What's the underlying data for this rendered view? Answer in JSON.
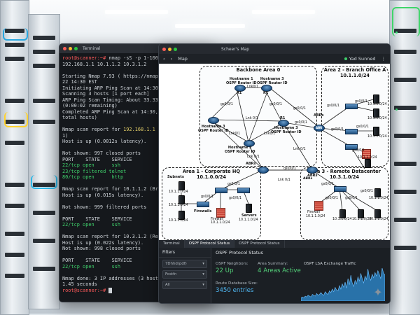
{
  "terminal": {
    "title": "Terminal",
    "prompt": "root@scanner:~#",
    "command": "nmap -sS -p 1-1000 -T4 -v 192.168.1.1 10.1.1.2 10.3.1.2",
    "lines": [
      {
        "text": "",
        "cls": ""
      },
      {
        "text": "Starting Nmap 7.93 ( https://nmap.org ) at 2024-05-22 14:30 EST",
        "cls": ""
      },
      {
        "text": "Initiating ARP Ping Scan at 14:30",
        "cls": ""
      },
      {
        "text": "Scanning 3 hosts [1 port each]",
        "cls": ""
      },
      {
        "text": "ARP Ping Scan Timing: About 33.33% done; ETC: 14:30 (0:00:02 remaining)",
        "cls": ""
      },
      {
        "text": "Completed ARP Ping Scan at 14:30, 0.01s elapsed (3 total hosts)",
        "cls": ""
      },
      {
        "text": "",
        "cls": ""
      },
      {
        "text": "Nmap scan report for 192.168.1.1 (Backbone Router 1)",
        "cls": "y1"
      },
      {
        "text": "Host is up (0.0012s latency).",
        "cls": ""
      },
      {
        "text": "",
        "cls": ""
      },
      {
        "text": "Not shown: 997 closed ports",
        "cls": ""
      },
      {
        "text": "PORT    STATE    SERVICE",
        "cls": ""
      },
      {
        "text": "22/tcp open      ssh",
        "cls": "g"
      },
      {
        "text": "23/tcp filtered telnet",
        "cls": "g"
      },
      {
        "text": "80/tcp open      http",
        "cls": "g"
      },
      {
        "text": "",
        "cls": ""
      },
      {
        "text": "Nmap scan report for 10.1.1.2 (Branch A Server)",
        "cls": ""
      },
      {
        "text": "Host is up (0.015s latency).",
        "cls": ""
      },
      {
        "text": "",
        "cls": ""
      },
      {
        "text": "Not shown: 999 filtered ports",
        "cls": ""
      },
      {
        "text": "",
        "cls": ""
      },
      {
        "text": "PORT    STATE    SERVICE",
        "cls": ""
      },
      {
        "text": "22/tcp open      ssh",
        "cls": "g"
      },
      {
        "text": "",
        "cls": ""
      },
      {
        "text": "Nmap scan report for 10.3.1.2 (Remote Server)",
        "cls": ""
      },
      {
        "text": "Host is up (0.022s latency).",
        "cls": ""
      },
      {
        "text": "Not shown: 998 closed ports",
        "cls": ""
      },
      {
        "text": "",
        "cls": ""
      },
      {
        "text": "PORT    STATE    SERVICE",
        "cls": ""
      },
      {
        "text": "22/tcp open      ssh",
        "cls": "g"
      },
      {
        "text": "",
        "cls": ""
      },
      {
        "text": "Nmap done: 3 IP addresses (3 hosts up) scanned in 1.45 seconds",
        "cls": ""
      }
    ],
    "final_prompt": "root@scanner:~#"
  },
  "map": {
    "window_title": "Scheer's Map",
    "toolbar_label": "Map",
    "status_label": "Yad Sunned",
    "areas": {
      "backbone": "Backbone Area 0",
      "branch_b_title": "Area 2 - Branch Office A",
      "branch_b_subnet": "10.1.1.0/24",
      "corp_title": "Area 1 - Corporate HQ",
      "corp_subnet": "10.1.0.0/24",
      "remote_title": "Area 3 - Remote Datacenter",
      "remote_subnet": "10.3.1.0/24"
    },
    "labels": {
      "h1": "Hostname 1",
      "h1b": "OSPF Router ID",
      "h2": "Hostname 3",
      "h2b": "OSPF Router ID",
      "h3": "Hostname 3",
      "h3b": "OSPF Router ID",
      "h4": "Hostname 3",
      "h4b": "OSPF Router ID",
      "h5": "Hostname 2",
      "h5b": "OSPF Router ID",
      "r1": "R1",
      "r2": "R1",
      "r3": "R1",
      "abrs_top": "ABRs",
      "abr": "ABR",
      "abrs_mid": "ABRs",
      "abrs_right": "ABRs",
      "abr_right": "ABRs",
      "subnets": "Subnets",
      "sub1": "10.1.1.0/24",
      "sub2": "10.1.1.0/24",
      "firewalls": "Firewalls",
      "firewall1": "Firewall",
      "servers": "Servers",
      "firewall2": "Firewall",
      "srv_a1": "10.1.1.0/24",
      "srv_a2": "10.1.1.0/24",
      "srv_a3": "10.1.1.0/24",
      "srv_a4": "10.1.1.0/24",
      "srv_c1": "10.1.1.0/24",
      "srv_c2": "10.1.1.0/24",
      "srv_c3": "10.1.1.0/24",
      "srv_c4": "10.1.1.0/24",
      "srv_c5": "10.1.1.0/24",
      "corp_fw_sub": "10.1.1.0/24",
      "corp_srv_sub": "10.1.1.0/24",
      "corp_sub3": "10.1.1.0/24",
      "link1": "gs0/0/1",
      "link2": "gs0/0/1",
      "link3": "Lnk0/1",
      "link4": "Lnk 0/1",
      "link5": "Lnk 0/1",
      "link6": "Lnk 0/1",
      "link7": "gs0/0/1",
      "link8": "gs0/0/1",
      "link9": "Lnk0/1",
      "link10": "Lnk0/1",
      "link11": "gs0/0/1",
      "link12": "gs0/0/1",
      "link13": "gs0/0/1",
      "link14": "gs0/0/1",
      "link15": "gs0/0/1",
      "link16": "gs0/0/1",
      "link17": "gs0/0/1",
      "link18": "gs0/0/1",
      "link19": "gs0/0/1",
      "link20": "gs0/0/1",
      "link21": "Lnk 0/1",
      "link22": "gs0/0/1",
      "link23": "gs0/0/1",
      "link24": "gs0/0/1"
    }
  },
  "panels": {
    "tabs": [
      "Terminal",
      "OSPF Protocol Status",
      "OSPF Protocol Status"
    ],
    "filters": "Filters",
    "filter1": "7Dhhd(pdf)",
    "filter2": "Fostfn",
    "filter3": "All",
    "status_title": "OSPF Protocol Status",
    "neighbors_label": "OSPF Neighbors:",
    "neighbors_value": "22 Up",
    "area_label": "Area Summary:",
    "area_value": "4 Areas Active",
    "lsa_label": "OSPF LSA Exchange Traffic",
    "db_label": "Route Database Size:",
    "db_value": "3450 entries"
  },
  "colors": {
    "prompt": "#ff5a5a",
    "open_port": "#3fd06b",
    "accent_green": "#54d27a",
    "chart_fill": "#2f8fd6"
  },
  "chart_data": {
    "type": "area",
    "title": "OSPF LSA Exchange Traffic",
    "xlabel": "",
    "ylabel": "",
    "values": [
      2,
      3,
      2,
      4,
      3,
      5,
      4,
      3,
      6,
      5,
      4,
      7,
      5,
      6,
      8,
      6,
      5,
      9,
      7,
      6,
      10,
      8,
      12,
      9,
      14,
      11,
      10,
      16,
      12,
      18,
      14,
      20,
      13,
      24,
      17,
      28,
      19,
      15,
      22,
      18,
      26,
      21,
      30,
      24,
      19,
      27,
      23,
      35,
      26,
      22,
      29,
      25,
      31,
      27,
      33,
      29,
      24,
      36,
      30,
      28
    ],
    "ylim": [
      0,
      40
    ]
  }
}
